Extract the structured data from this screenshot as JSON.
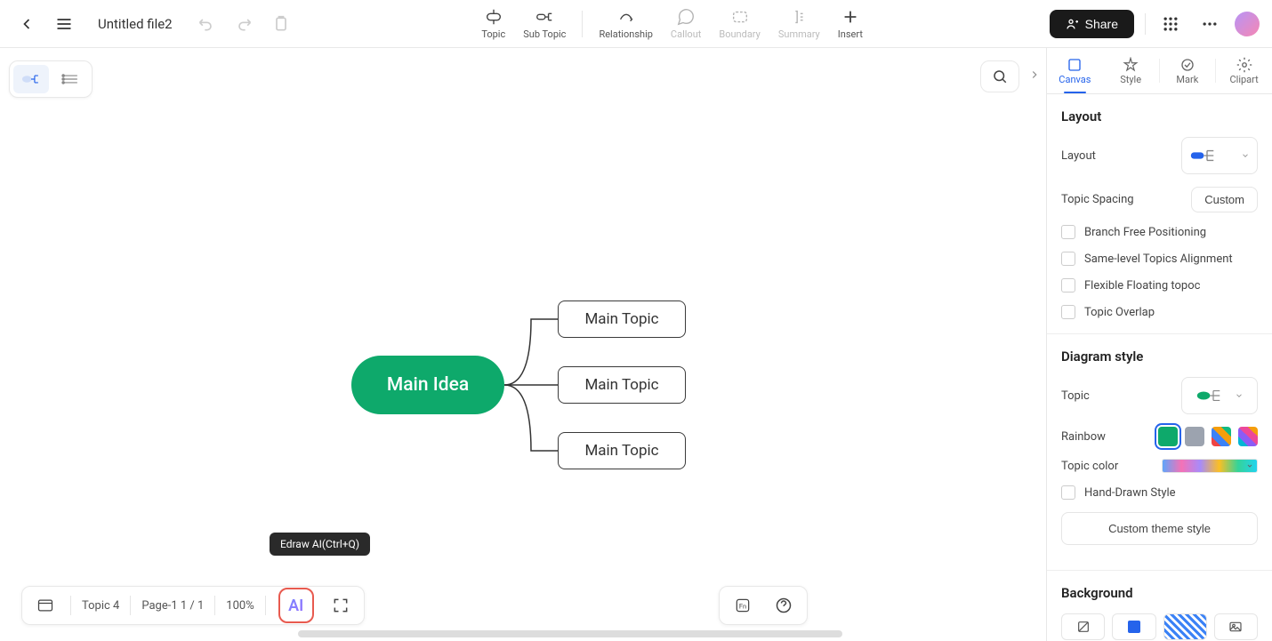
{
  "header": {
    "file_name": "Untitled file2",
    "share_label": "Share"
  },
  "toolbar": {
    "topic": "Topic",
    "sub_topic": "Sub Topic",
    "relationship": "Relationship",
    "callout": "Callout",
    "boundary": "Boundary",
    "summary": "Summary",
    "insert": "Insert"
  },
  "mindmap": {
    "main_idea": "Main Idea",
    "topic_1": "Main Topic",
    "topic_2": "Main Topic",
    "topic_3": "Main Topic"
  },
  "tooltip": "Edraw AI(Ctrl+Q)",
  "bottom": {
    "topic_count": "Topic 4",
    "page_info": "Page-1  1 / 1",
    "zoom": "100%",
    "ai_label": "AI"
  },
  "panel": {
    "tabs": {
      "canvas": "Canvas",
      "style": "Style",
      "mark": "Mark",
      "clipart": "Clipart"
    },
    "layout": {
      "title": "Layout",
      "layout_label": "Layout",
      "spacing_label": "Topic Spacing",
      "custom_btn": "Custom",
      "opt_branch": "Branch Free Positioning",
      "opt_same_level": "Same-level Topics Alignment",
      "opt_flexible": "Flexible Floating topoc",
      "opt_overlap": "Topic Overlap"
    },
    "diagram": {
      "title": "Diagram style",
      "topic_label": "Topic",
      "rainbow_label": "Rainbow",
      "topic_color_label": "Topic color",
      "hand_drawn": "Hand-Drawn Style",
      "custom_theme": "Custom theme style"
    },
    "background": {
      "title": "Background"
    }
  }
}
